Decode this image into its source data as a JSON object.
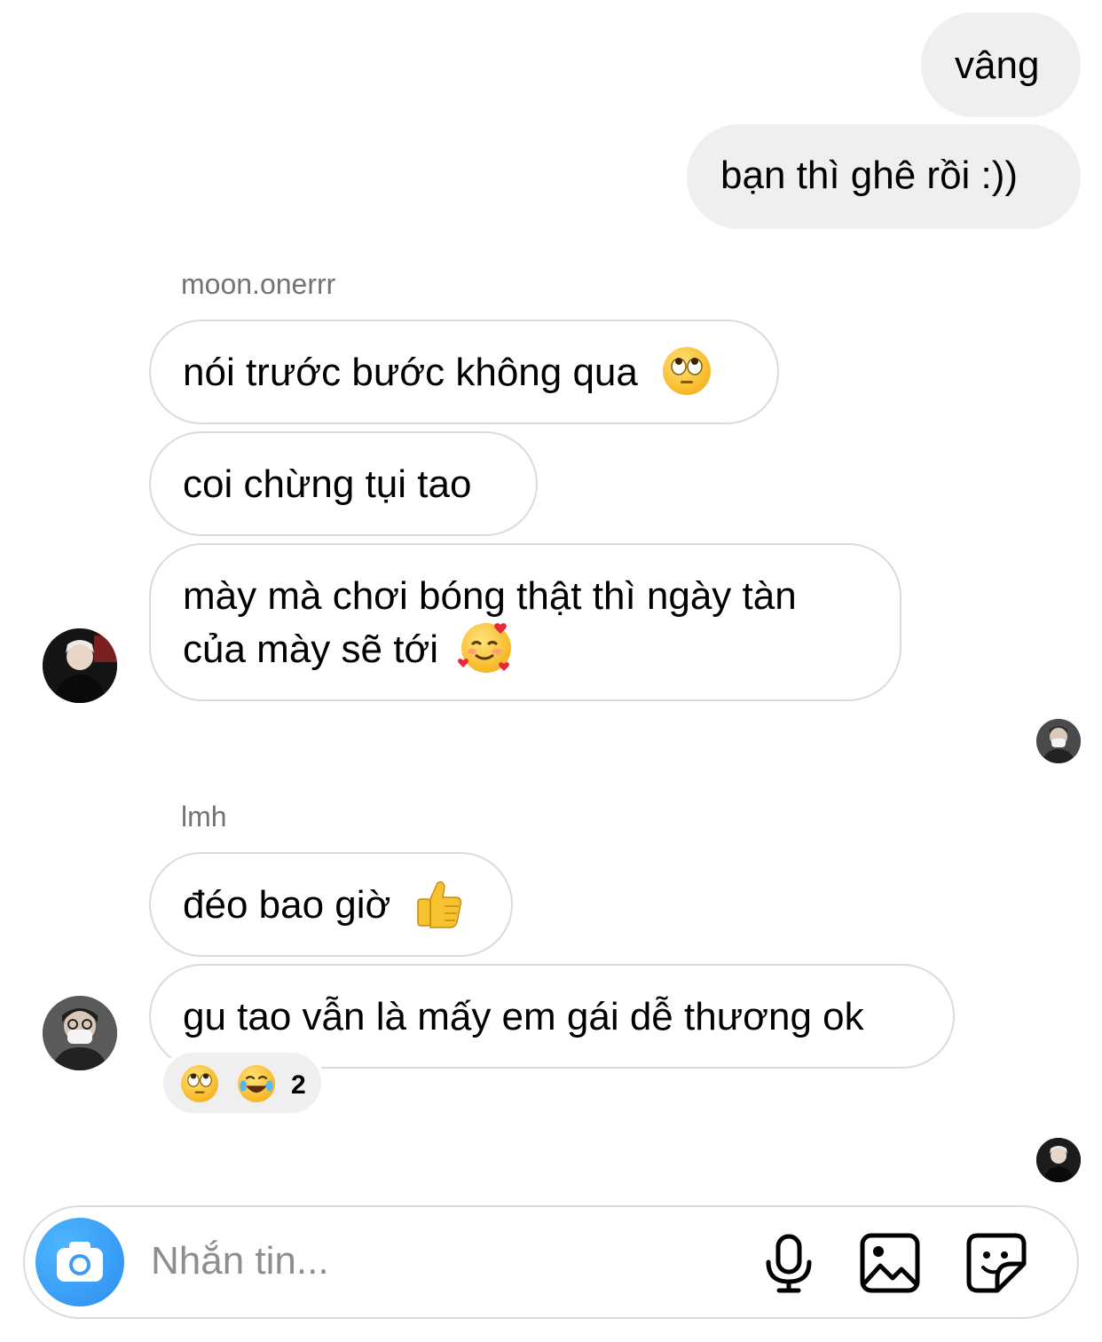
{
  "thread": {
    "outgoing": [
      {
        "text": "vâng"
      },
      {
        "text": "bạn thì ghê rồi :))"
      }
    ],
    "group1": {
      "sender": "moon.onerrr",
      "messages": [
        {
          "text": "nói trước bước không qua",
          "emoji": "face-with-rolling-eyes"
        },
        {
          "text": "coi chừng tụi tao"
        },
        {
          "line1": "mày mà chơi bóng thật thì ngày tàn",
          "line2": "của mày sẽ tới",
          "emoji": "smiling-face-with-hearts"
        }
      ]
    },
    "group2": {
      "sender": "lmh",
      "messages": [
        {
          "text": "đéo bao giờ",
          "emoji": "thumbs-up"
        },
        {
          "text": "gu tao vẫn là mấy em gái dễ thương ok"
        }
      ],
      "reactions": {
        "emojis": [
          "face-with-rolling-eyes",
          "face-with-tears-of-joy"
        ],
        "count": "2"
      }
    }
  },
  "composer": {
    "placeholder": "Nhắn tin...",
    "icons": [
      "camera-icon",
      "microphone-icon",
      "gallery-icon",
      "sticker-icon"
    ],
    "camera_color": "#3897f0"
  }
}
